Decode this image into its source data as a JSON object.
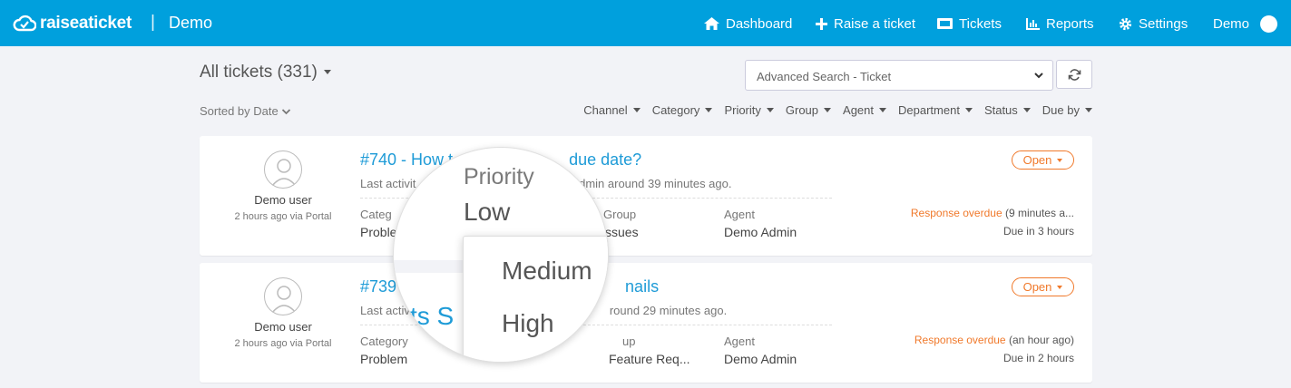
{
  "nav": {
    "brand": "raiseaticket",
    "separator": "|",
    "app_name": "Demo",
    "items": [
      {
        "label": "Dashboard",
        "icon": "home-icon"
      },
      {
        "label": "Raise a ticket",
        "icon": "plus-icon"
      },
      {
        "label": "Tickets",
        "icon": "ticket-icon"
      },
      {
        "label": "Reports",
        "icon": "chart-icon"
      },
      {
        "label": "Settings",
        "icon": "gear-icon"
      }
    ],
    "user": "Demo"
  },
  "toolbar": {
    "title": "All tickets (331)",
    "search_placeholder": "Advanced Search - Ticket",
    "sorted_by": "Sorted by Date",
    "filters": [
      "Channel",
      "Category",
      "Priority",
      "Group",
      "Agent",
      "Department",
      "Status",
      "Due by"
    ]
  },
  "tickets": [
    {
      "requester": "Demo user",
      "requester_meta": "2 hours ago via Portal",
      "title": "#740 - How t",
      "title_tail": "due date?",
      "activity_prefix": "Last activit",
      "activity_suffix": "Admin around 39 minutes ago.",
      "category_label": "Categ",
      "category_value": "Proble",
      "group_label": "Group",
      "group_value": "ssues",
      "agent_label": "Agent",
      "agent_value": "Demo Admin",
      "status": "Open",
      "overdue_label": "Response overdue",
      "overdue_detail": " (9 minutes a...",
      "due": "Due in 3 hours"
    },
    {
      "requester": "Demo user",
      "requester_meta": "2 hours ago via Portal",
      "title": "#739",
      "title_tail": "nails",
      "activity_prefix": "Last activi",
      "activity_suffix": "round 29 minutes ago.",
      "category_label": "Category",
      "category_value": "Problem",
      "group_label": "up",
      "group_value": "Feature Req...",
      "agent_label": "Agent",
      "agent_value": "Demo Admin",
      "status": "Open",
      "overdue_label": "Response overdue",
      "overdue_detail": " (an hour ago)",
      "due": "Due in 2 hours"
    }
  ],
  "magnifier": {
    "field_label": "Priority",
    "current_value": "Low",
    "options": [
      "Medium",
      "High"
    ],
    "behind_text": "ts S"
  },
  "colors": {
    "nav_bg": "#00a0dd",
    "link": "#1e9bd7",
    "accent_orange": "#f0792b",
    "page_bg": "#f2f3f7"
  }
}
